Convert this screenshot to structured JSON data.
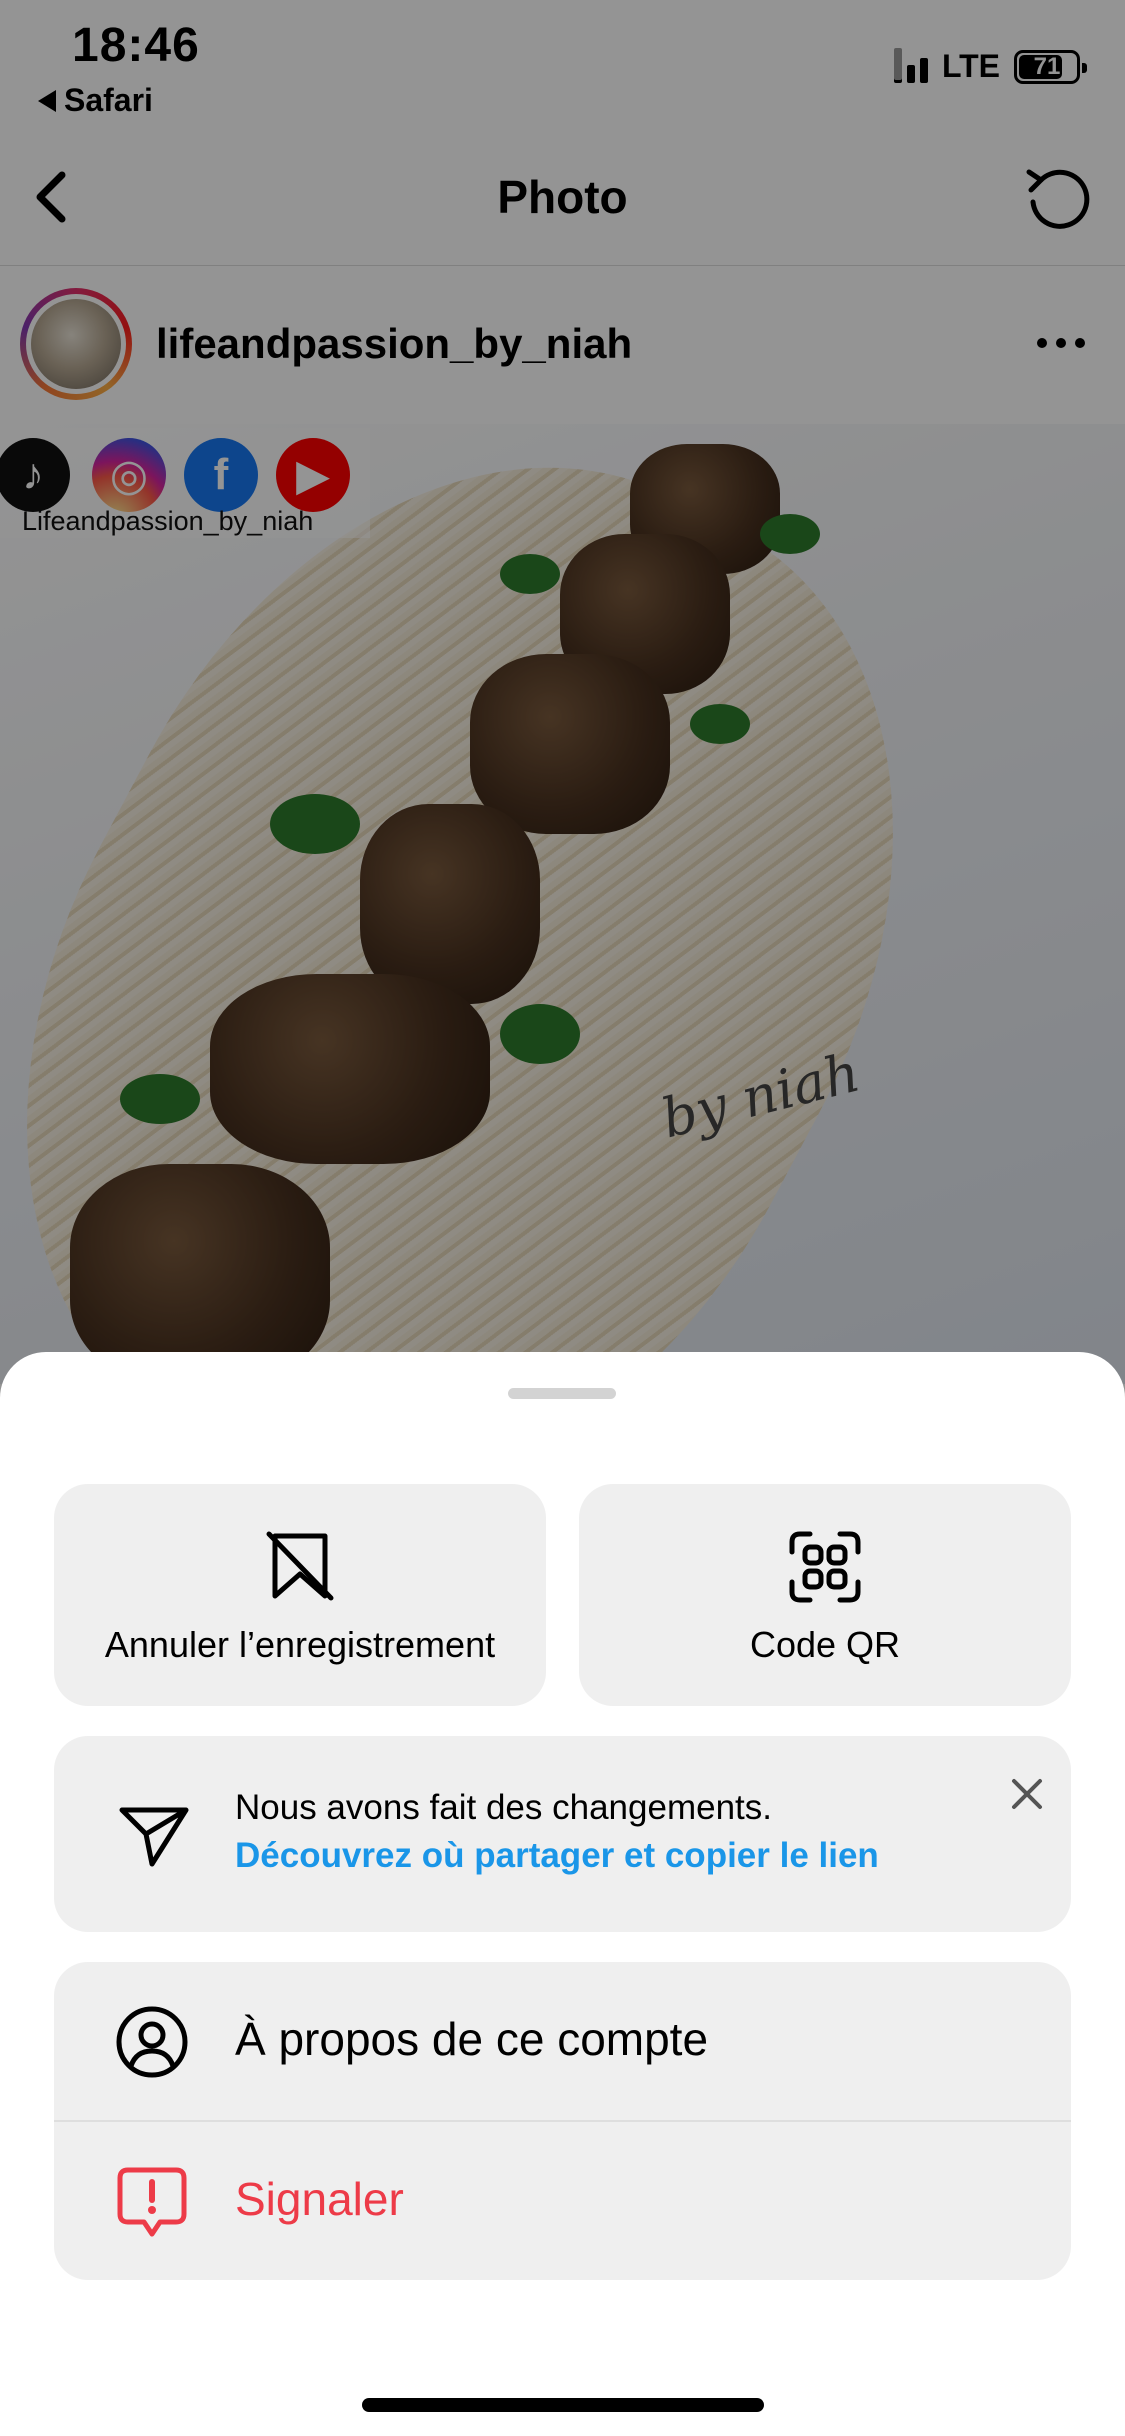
{
  "status_bar": {
    "time": "18:46",
    "back_app": "Safari",
    "network": "LTE",
    "battery": "71"
  },
  "nav": {
    "title": "Photo"
  },
  "post": {
    "username": "lifeandpassion_by_niah",
    "photo": {
      "social_handle": "Lifeandpassion_by_niah",
      "watermark": "by niah"
    }
  },
  "sheet": {
    "actions": [
      {
        "label": "Annuler l’enregistrement",
        "icon": "unsave-bookmark-icon"
      },
      {
        "label": "Code QR",
        "icon": "qr-code-icon"
      }
    ],
    "notice": {
      "line1": "Nous avons fait des changements.",
      "link": "Découvrez où partager et copier le lien",
      "link_color": "#1a96e8"
    },
    "menu": [
      {
        "label": "À propos de ce compte",
        "icon": "account-icon"
      },
      {
        "label": "Signaler",
        "icon": "report-icon",
        "color": "#ed3b48"
      }
    ]
  }
}
